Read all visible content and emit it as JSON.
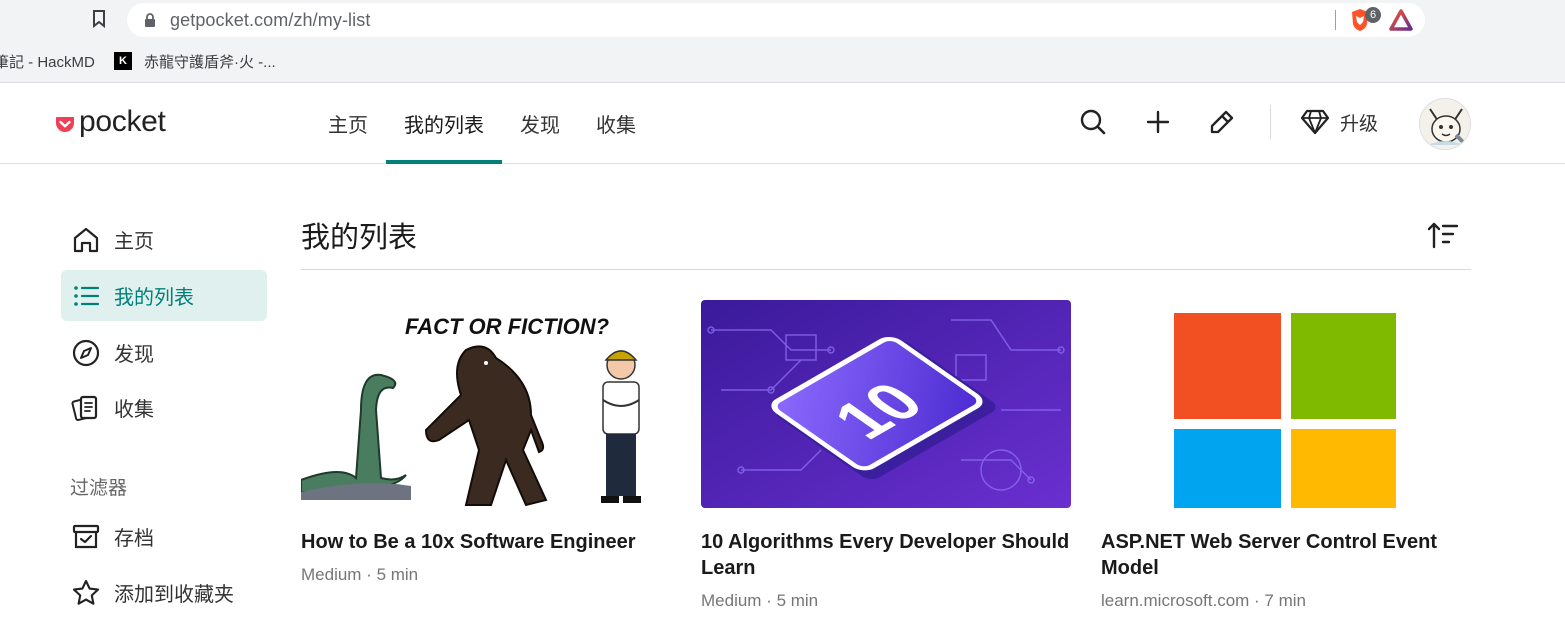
{
  "browser": {
    "url": "getpocket.com/zh/my-list",
    "shield_count": "6",
    "bookmarks": [
      {
        "label": "筆記 - HackMD"
      },
      {
        "label": "赤龍守護盾斧·火 -...",
        "favicon_letter": "K"
      }
    ]
  },
  "header": {
    "logo_text": "pocket",
    "nav": [
      {
        "label": "主页",
        "active": false
      },
      {
        "label": "我的列表",
        "active": true
      },
      {
        "label": "发现",
        "active": false
      },
      {
        "label": "收集",
        "active": false
      }
    ],
    "upgrade_label": "升级"
  },
  "sidebar": {
    "items": [
      {
        "label": "主页",
        "icon": "home-icon"
      },
      {
        "label": "我的列表",
        "icon": "list-icon",
        "active": true
      },
      {
        "label": "发现",
        "icon": "compass-icon"
      },
      {
        "label": "收集",
        "icon": "collections-icon"
      }
    ],
    "filters_heading": "过滤器",
    "filters": [
      {
        "label": "存档",
        "icon": "archive-icon"
      },
      {
        "label": "添加到收藏夹",
        "icon": "star-icon"
      }
    ]
  },
  "main": {
    "title": "我的列表",
    "cards": [
      {
        "title": "How to Be a 10x Software Engineer",
        "source": "Medium",
        "read_time": "5 min",
        "meta": "Medium · 5 min",
        "thumb_text": "FACT OR FICTION?"
      },
      {
        "title": "10 Algorithms Every Developer Should Learn",
        "source": "Medium",
        "read_time": "5 min",
        "meta": "Medium · 5 min",
        "thumb_text": "10"
      },
      {
        "title": "ASP.NET Web Server Control Event Model",
        "source": "learn.microsoft.com",
        "read_time": "7 min",
        "meta": "learn.microsoft.com · 7 min"
      }
    ]
  },
  "colors": {
    "accent": "#008078",
    "accent_bg": "#dff0ef",
    "pocket_red": "#ef4056",
    "ms_red": "#f25022",
    "ms_green": "#7fba00",
    "ms_blue": "#00a4ef",
    "ms_yellow": "#ffb900",
    "algo_purple": "#5a2bb5"
  }
}
